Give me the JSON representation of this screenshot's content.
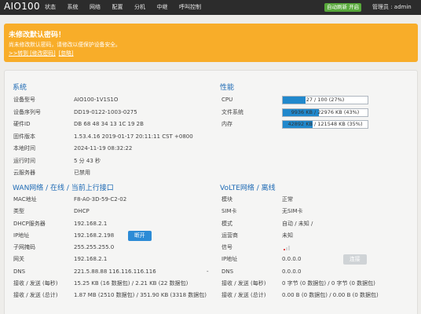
{
  "header": {
    "brand": "AIO100",
    "nav": [
      "状态",
      "系统",
      "网络",
      "配置",
      "分机",
      "中继",
      "呼叫控制"
    ],
    "mode_badge": "自动刷新 开启",
    "user_text": "管理员 : admin"
  },
  "warning": {
    "title": "未修改默认密码！",
    "message": "尚未修改默认密码，请修改以便保护设备安全。",
    "links": [
      ">>转到 [修改密码]",
      "[忽略]"
    ]
  },
  "system": {
    "title": "系统",
    "rows": [
      {
        "label": "设备型号",
        "value": "AIO100-1V1S1O"
      },
      {
        "label": "设备序列号",
        "value": "DD19-0122-1003-0275"
      },
      {
        "label": "硬件ID",
        "value": "DB 68 48 34 13 1C 19 2B"
      },
      {
        "label": "固件版本",
        "value": "1.53.4.16 2019-01-17 20:11:11 CST +0800"
      },
      {
        "label": "本地时间",
        "value": "2024-11-19 08:32:22"
      },
      {
        "label": "运行时间",
        "value": "5 分 43 秒"
      },
      {
        "label": "云服务器",
        "value": "已禁用"
      }
    ]
  },
  "performance": {
    "title": "性能",
    "rows": [
      {
        "label": "CPU",
        "text": "27 / 100 (27%)",
        "percent": 27
      },
      {
        "label": "文件系统",
        "text": "9936 KB / 22976 KB (43%)",
        "percent": 43
      },
      {
        "label": "内存",
        "text": "42892 KB / 121548 KB (35%)",
        "percent": 35
      }
    ]
  },
  "wan": {
    "title": "WAN网络 / 在线 / 当前上行接口",
    "button": "断开",
    "rows": [
      {
        "label": "MAC地址",
        "value": "F8-A0-3D-59-C2-02"
      },
      {
        "label": "类型",
        "value": "DHCP"
      },
      {
        "label": "DHCP服务器",
        "value": "192.168.2.1"
      },
      {
        "label": "IP地址",
        "value": "192.168.2.198"
      },
      {
        "label": "子网掩码",
        "value": "255.255.255.0"
      },
      {
        "label": "网关",
        "value": "192.168.2.1"
      },
      {
        "label": "DNS",
        "value": "221.5.88.88 116.116.116.116",
        "extra": "-"
      },
      {
        "label": "接收 / 发送 (每秒)",
        "value": "15.25 KB (16 数据包) / 2.21 KB (22 数据包)"
      },
      {
        "label": "接收 / 发送 (总计)",
        "value": "1.87 MB (2510 数据包) / 351.90 KB (3318 数据包)"
      }
    ]
  },
  "lte": {
    "title": "VoLTE网络 / 离线",
    "button": "连接",
    "rows": [
      {
        "label": "模块",
        "value": "正常"
      },
      {
        "label": "SIM卡",
        "value": "无SIM卡"
      },
      {
        "label": "模式",
        "value": "自动 / 未知 /"
      },
      {
        "label": "运营商",
        "value": "未知"
      },
      {
        "label": "信号",
        "value": ""
      },
      {
        "label": "IP地址",
        "value": "0.0.0.0"
      },
      {
        "label": "DNS",
        "value": "0.0.0.0"
      },
      {
        "label": "接收 / 发送 (每秒)",
        "value": "0 字节 (0 数据包) / 0 字节 (0 数据包)"
      },
      {
        "label": "接收 / 发送 (总计)",
        "value": "0.00 B (0 数据包) / 0.00 B (0 数据包)"
      }
    ]
  },
  "colors": {
    "topbar": "#2c2c2c",
    "accent": "#1c69b4",
    "warning": "#f8ad29",
    "progress": "#2188cc",
    "badge": "#57a83a"
  }
}
